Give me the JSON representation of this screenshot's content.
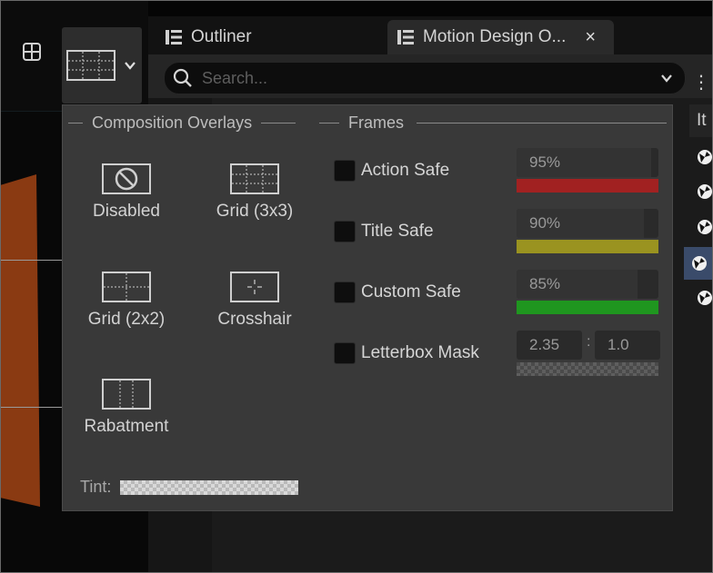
{
  "tabs": [
    {
      "label": "Outliner",
      "icon": "outliner-icon"
    },
    {
      "label": "Motion Design O...",
      "icon": "outliner-icon",
      "close": "×"
    }
  ],
  "search": {
    "placeholder": "Search...",
    "value": ""
  },
  "more_menu": "⋮",
  "column_header": "It",
  "popup": {
    "overlays_title": "Composition Overlays",
    "frames_title": "Frames",
    "overlays": [
      {
        "label": "Disabled",
        "icon": "no-overlay-icon"
      },
      {
        "label": "Grid (3x3)",
        "icon": "grid-3x3-icon"
      },
      {
        "label": "Grid (2x2)",
        "icon": "grid-2x2-icon"
      },
      {
        "label": "Crosshair",
        "icon": "crosshair-icon"
      },
      {
        "label": "Rabatment",
        "icon": "rabatment-icon"
      }
    ],
    "tint_label": "Tint:",
    "frames": [
      {
        "label": "Action Safe",
        "value": "95%",
        "fill": 0.95,
        "color": "#a12121"
      },
      {
        "label": "Title Safe",
        "value": "90%",
        "fill": 0.9,
        "color": "#9a9320"
      },
      {
        "label": "Custom Safe",
        "value": "85%",
        "fill": 0.85,
        "color": "#1f961f"
      }
    ],
    "letterbox": {
      "label": "Letterbox Mask",
      "ratio_a": "2.35",
      "separator": ":",
      "ratio_b": "1.0"
    }
  },
  "colors": {
    "viewport_plane": "#8a3a12",
    "selection": "#3a4b6a"
  }
}
